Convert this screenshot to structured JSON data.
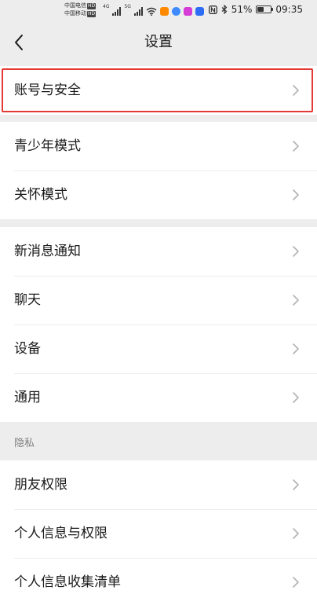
{
  "status_bar": {
    "carrier_1": "中国电信",
    "carrier_2": "中国移动",
    "hd_badge": "HD",
    "network_tag_1": "4G",
    "network_tag_2": "5G",
    "battery_percent": "51%",
    "battery_level": 0.51,
    "time": "09:35",
    "icons": [
      "nfc-icon",
      "bluetooth-icon",
      "wifi-icon",
      "signal-icon"
    ],
    "app_colors": [
      "#ff8a00",
      "#3d8bff",
      "#d63cd6",
      "#2d6df6"
    ]
  },
  "nav": {
    "title": "设置",
    "back_icon": "chevron-left-icon"
  },
  "sections": {
    "account": {
      "items": [
        {
          "label": "账号与安全"
        }
      ]
    },
    "modes": {
      "items": [
        {
          "label": "青少年模式"
        },
        {
          "label": "关怀模式"
        }
      ]
    },
    "general": {
      "items": [
        {
          "label": "新消息通知"
        },
        {
          "label": "聊天"
        },
        {
          "label": "设备"
        },
        {
          "label": "通用"
        }
      ]
    },
    "privacy": {
      "header": "隐私",
      "items": [
        {
          "label": "朋友权限"
        },
        {
          "label": "个人信息与权限"
        },
        {
          "label": "个人信息收集清单"
        }
      ]
    }
  },
  "colors": {
    "background": "#ededed",
    "row_background": "#ffffff",
    "highlight": "#e53935",
    "chevron": "#b2b2b2"
  }
}
